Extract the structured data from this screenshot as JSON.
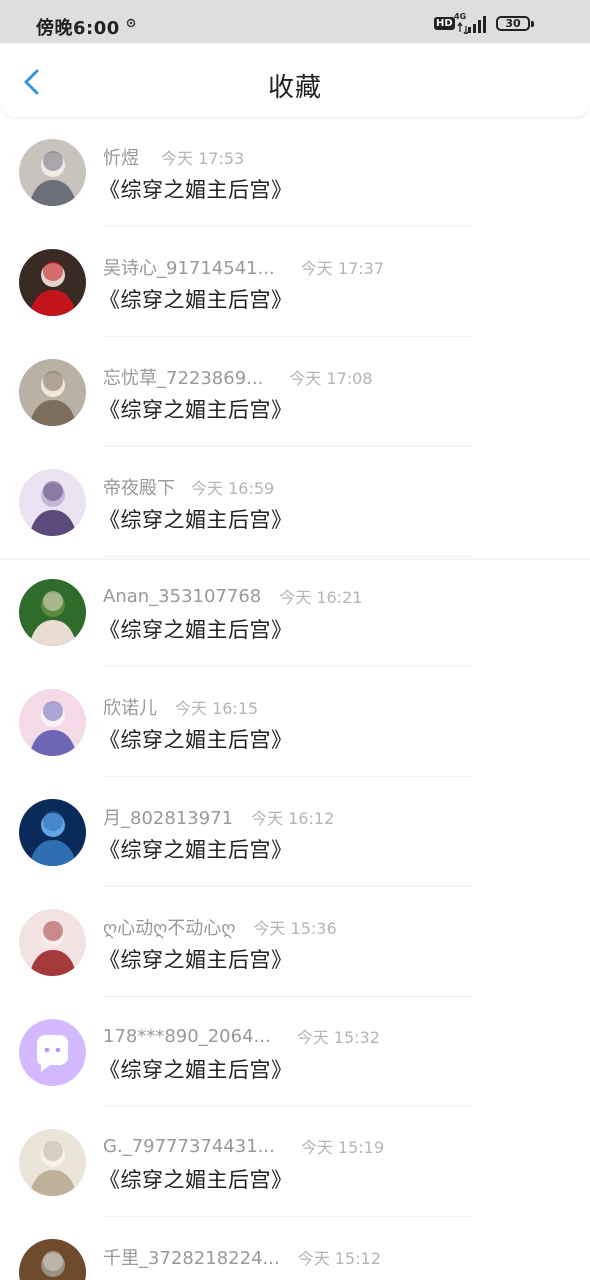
{
  "status_bar": {
    "time": "傍晚6:00",
    "network": "4G",
    "hd": "HD",
    "battery": "30"
  },
  "header": {
    "title": "收藏"
  },
  "colors": {
    "accent": "#2f98e6",
    "username": "#999999",
    "timestamp": "#b5b5b5",
    "book_title": "#222222"
  },
  "items": [
    {
      "user": "忻煜",
      "time": "今天 17:53",
      "book": "《综穿之媚主后宫》",
      "avatar": "photo-avatar"
    },
    {
      "user": "吴诗心_91714541...",
      "time": "今天 17:37",
      "book": "《综穿之媚主后宫》",
      "avatar": "photo-avatar"
    },
    {
      "user": "忘忧草_7223869...",
      "time": "今天 17:08",
      "book": "《综穿之媚主后宫》",
      "avatar": "photo-avatar"
    },
    {
      "user": "帝夜殿下",
      "time": "今天 16:59",
      "book": "《综穿之媚主后宫》",
      "avatar": "anime-avatar"
    },
    {
      "user": "Anan_353107768",
      "time": "今天 16:21",
      "book": "《综穿之媚主后宫》",
      "avatar": "photo-avatar"
    },
    {
      "user": "欣诺儿",
      "time": "今天 16:15",
      "book": "《综穿之媚主后宫》",
      "avatar": "anime-avatar"
    },
    {
      "user": "月_802813971",
      "time": "今天 16:12",
      "book": "《综穿之媚主后宫》",
      "avatar": "photo-avatar"
    },
    {
      "user": "ღ心动ღ不动心ღ",
      "time": "今天 15:36",
      "book": "《综穿之媚主后宫》",
      "avatar": "anime-avatar"
    },
    {
      "user": "178***890_2064...",
      "time": "今天 15:32",
      "book": "《综穿之媚主后宫》",
      "avatar": "chat-bubble-icon"
    },
    {
      "user": "G._79777374431...",
      "time": "今天 15:19",
      "book": "《综穿之媚主后宫》",
      "avatar": "anime-avatar"
    },
    {
      "user": "千里_3728218224...",
      "time": "今天 15:12",
      "book": "",
      "avatar": "photo-avatar"
    }
  ]
}
